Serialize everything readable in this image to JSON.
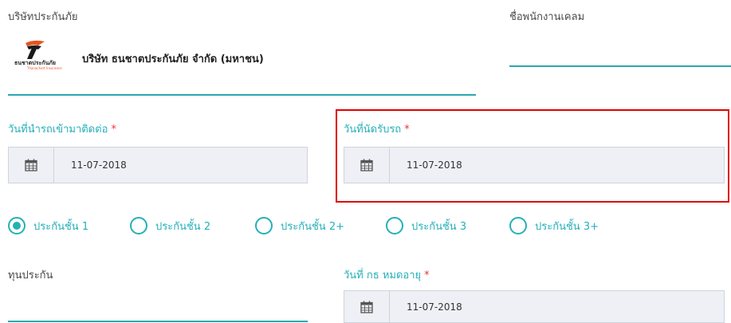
{
  "company": {
    "label": "บริษัทประกันภัย",
    "logo_text_main": "ธนชาตประกันภัย",
    "logo_text_sub": "Thanachart Insurance",
    "name": "บริษัท ธนชาตประกันภัย จำกัด (มหาชน)"
  },
  "claim_officer": {
    "label": "ชื่อพนักงานเคลม",
    "value": ""
  },
  "car_arrival_date": {
    "label": "วันที่นำรถเข้ามาติดต่อ",
    "required_mark": "*",
    "value": "11-07-2018",
    "icon": "calendar-icon"
  },
  "pickup_date": {
    "label": "วันที่นัดรับรถ",
    "required_mark": "*",
    "value": "11-07-2018",
    "icon": "calendar-icon"
  },
  "insurance_class": {
    "options": [
      {
        "label": "ประกันชั้น 1",
        "selected": true
      },
      {
        "label": "ประกันชั้น 2",
        "selected": false
      },
      {
        "label": "ประกันชั้น 2+",
        "selected": false
      },
      {
        "label": "ประกันชั้น 3",
        "selected": false
      },
      {
        "label": "ประกันชั้น 3+",
        "selected": false
      }
    ]
  },
  "sum_insured": {
    "label": "ทุนประกัน",
    "value": ""
  },
  "policy_expiry": {
    "label": "วันที่ กธ หมดอายุ",
    "required_mark": "*",
    "value": "11-07-2018",
    "icon": "calendar-icon"
  },
  "colors": {
    "accent": "#25b0b8",
    "required": "#e53935",
    "highlight": "#e00000"
  }
}
